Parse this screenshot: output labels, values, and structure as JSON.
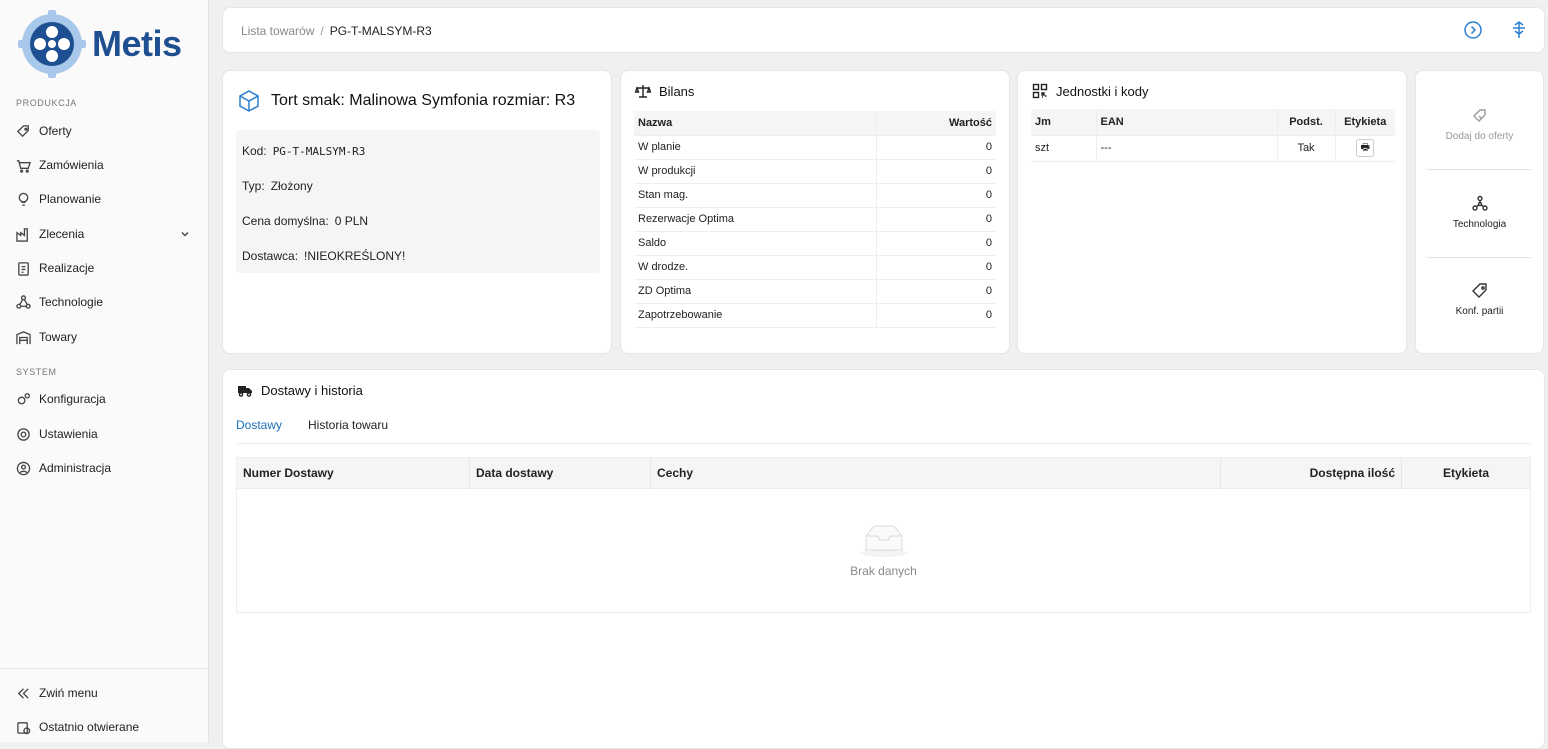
{
  "brand": {
    "name": "Metis"
  },
  "sidebar": {
    "section_production": "PRODUKCJA",
    "section_system": "SYSTEM",
    "items_production": [
      {
        "label": "Oferty",
        "icon": "tag-icon"
      },
      {
        "label": "Zamówienia",
        "icon": "cart-icon"
      },
      {
        "label": "Planowanie",
        "icon": "bulb-icon"
      },
      {
        "label": "Zlecenia",
        "icon": "factory-icon"
      },
      {
        "label": "Realizacje",
        "icon": "clipboard-icon"
      },
      {
        "label": "Technologie",
        "icon": "nodes-icon"
      },
      {
        "label": "Towary",
        "icon": "warehouse-icon"
      }
    ],
    "items_system": [
      {
        "label": "Konfiguracja",
        "icon": "gears-icon"
      },
      {
        "label": "Ustawienia",
        "icon": "gear-icon"
      },
      {
        "label": "Administracja",
        "icon": "user-shield-icon"
      }
    ],
    "collapse_label": "Zwiń menu",
    "recent_label": "Ostatnio otwierane"
  },
  "breadcrumb": {
    "parent": "Lista towarów",
    "separator": "/",
    "current": "PG-T-MALSYM-R3"
  },
  "product": {
    "title": "Tort smak: Malinowa Symfonia rozmiar: R3",
    "code_label": "Kod:",
    "code": "PG-T-MALSYM-R3",
    "type_label": "Typ:",
    "type": "Złożony",
    "price_label": "Cena domyślna:",
    "price": "0 PLN",
    "supplier_label": "Dostawca:",
    "supplier": "!NIEOKREŚLONY!"
  },
  "balance": {
    "title": "Bilans",
    "col_name": "Nazwa",
    "col_value": "Wartość",
    "rows": [
      {
        "name": "W planie",
        "value": "0"
      },
      {
        "name": "W produkcji",
        "value": "0"
      },
      {
        "name": "Stan mag.",
        "value": "0"
      },
      {
        "name": "Rezerwacje Optima",
        "value": "0"
      },
      {
        "name": "Saldo",
        "value": "0"
      },
      {
        "name": "W drodze.",
        "value": "0"
      },
      {
        "name": "ZD Optima",
        "value": "0"
      },
      {
        "name": "Zapotrzebowanie",
        "value": "0"
      }
    ]
  },
  "units": {
    "title": "Jednostki i kody",
    "col_jm": "Jm",
    "col_ean": "EAN",
    "col_base": "Podst.",
    "col_label": "Etykieta",
    "rows": [
      {
        "jm": "szt",
        "ean": "---",
        "base": "Tak"
      }
    ]
  },
  "actions": {
    "add_offer": "Dodaj do oferty",
    "technology": "Technologia",
    "batch_config": "Konf. partii"
  },
  "deliveries": {
    "title": "Dostawy i historia",
    "tab_deliveries": "Dostawy",
    "tab_history": "Historia towaru",
    "col_number": "Numer Dostawy",
    "col_date": "Data dostawy",
    "col_features": "Cechy",
    "col_qty": "Dostępna ilość",
    "col_label": "Etykieta",
    "empty": "Brak danych"
  },
  "colors": {
    "accent": "#2b7fd0",
    "brand": "#1d4f91"
  }
}
